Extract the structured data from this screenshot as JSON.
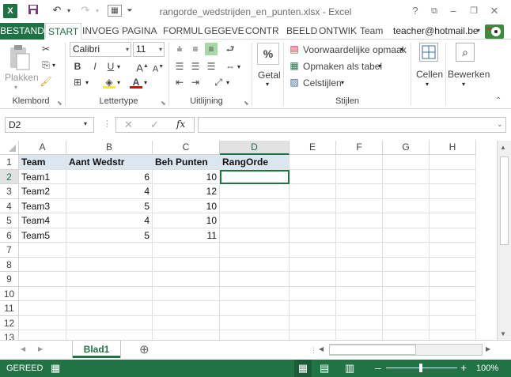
{
  "window": {
    "title": "rangorde_wedstrijden_en_punten.xlsx - Excel",
    "help": "?",
    "minimize": "–",
    "close": "✕",
    "account": "teacher@hotmail.be"
  },
  "tabs": [
    "BESTAND",
    "START",
    "INVOEG",
    "PAGINA",
    "FORMUL",
    "GEGEVE",
    "CONTR",
    "BEELD",
    "ONTWIK",
    "Team"
  ],
  "ribbon": {
    "paste_label": "Plakken",
    "font_name": "Calibri",
    "font_size": "11",
    "bold": "B",
    "italic": "I",
    "underline": "U",
    "number_label": "Getal",
    "percent": "%",
    "cond_format": "Voorwaardelijke opmaak",
    "format_table": "Opmaken als tabel",
    "cell_styles": "Celstijlen",
    "cells_label": "Cellen",
    "editing_label": "Bewerken",
    "groups": {
      "clipboard": "Klembord",
      "font": "Lettertype",
      "alignment": "Uitlijning",
      "styles": "Stijlen"
    }
  },
  "formula_bar": {
    "name_box": "D2",
    "fx": "fx",
    "value": ""
  },
  "columns": [
    "A",
    "B",
    "C",
    "D",
    "E",
    "F",
    "G",
    "H"
  ],
  "rows": [
    "1",
    "2",
    "3",
    "4",
    "5",
    "6",
    "7",
    "8",
    "9",
    "10",
    "11",
    "12",
    "13"
  ],
  "table": {
    "headers": [
      "Team",
      "Aant Wedstr",
      "Beh Punten",
      "RangOrde"
    ],
    "rows": [
      [
        "Team1",
        "6",
        "10",
        ""
      ],
      [
        "Team2",
        "4",
        "12",
        ""
      ],
      [
        "Team3",
        "5",
        "10",
        ""
      ],
      [
        "Team4",
        "4",
        "10",
        ""
      ],
      [
        "Team5",
        "5",
        "11",
        ""
      ]
    ]
  },
  "sheet": {
    "tab": "Blad1",
    "add": "⊕"
  },
  "status": {
    "ready": "GEREED",
    "zoom": "100%",
    "minus": "–",
    "plus": "+"
  }
}
